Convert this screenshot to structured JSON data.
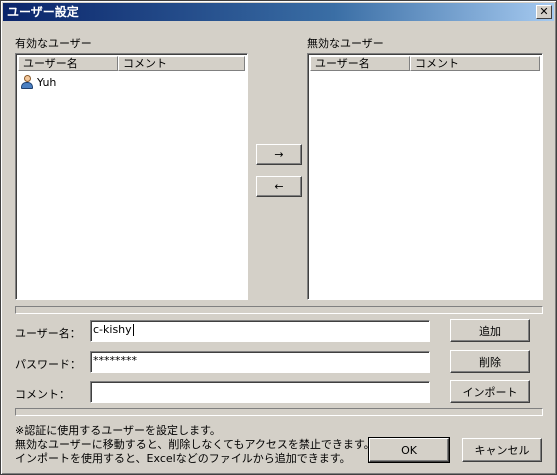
{
  "window": {
    "title": "ユーザー設定",
    "close_glyph": "✕"
  },
  "enabled_users": {
    "heading": "有効なユーザー",
    "columns": [
      "ユーザー名",
      "コメント"
    ],
    "rows": [
      {
        "name": "Yuh",
        "comment": "",
        "icon": "user-icon"
      }
    ]
  },
  "disabled_users": {
    "heading": "無効なユーザー",
    "columns": [
      "ユーザー名",
      "コメント"
    ],
    "rows": []
  },
  "transfer": {
    "move_right": "→",
    "move_left": "←"
  },
  "form": {
    "username_label": "ユーザー名：",
    "username_value": "c-kishy",
    "password_label": "パスワード：",
    "password_value": "********",
    "comment_label": "コメント：",
    "comment_value": ""
  },
  "actions": {
    "add": "追加",
    "delete": "削除",
    "import": "インポート"
  },
  "notes": [
    "※認証に使用するユーザーを設定します。",
    "無効なユーザーに移動すると、削除しなくてもアクセスを禁止できます。",
    "インポートを使用すると、Excelなどのファイルから追加できます。"
  ],
  "footer": {
    "ok": "OK",
    "cancel": "キャンセル"
  }
}
